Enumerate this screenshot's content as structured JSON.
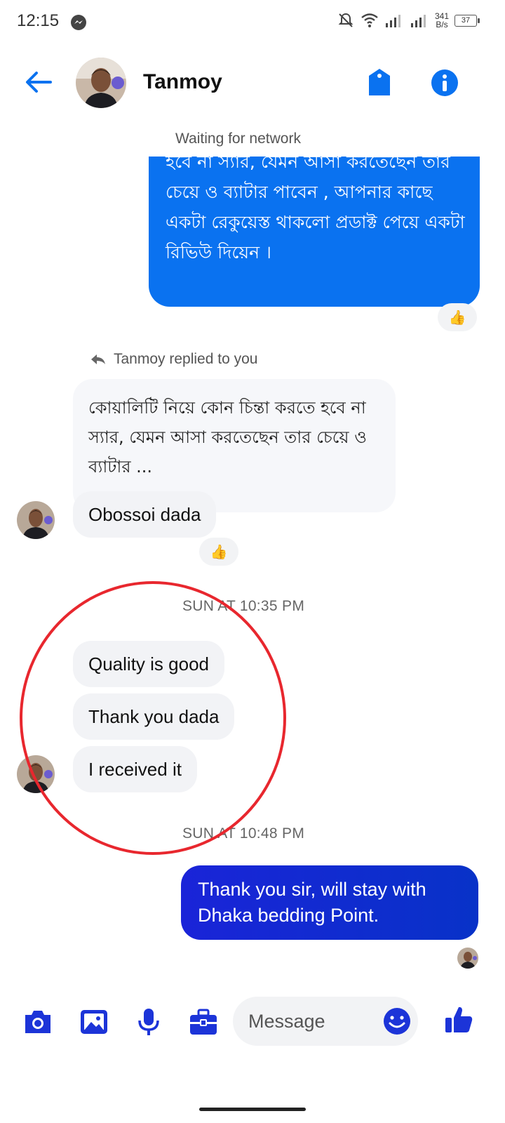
{
  "status_bar": {
    "time": "12:15",
    "net_speed_value": "341",
    "net_speed_unit": "B/s",
    "battery": "37"
  },
  "header": {
    "contact_name": "Tanmoy"
  },
  "network_status": "Waiting for network",
  "messages": {
    "outgoing_1": "হবে না স্যার, যেমন আসা করতেছেন তার চেয়ে ও ব্যাটার পাবেন , আপনার কাছে একটা রেকুয়েস্ত থাকলো প্রডাক্ট পেয়ে একটা রিভিউ দিয়েন ।",
    "reply_label": "Tanmoy replied to you",
    "quoted_text": "কোয়ালিটি নিয়ে কোন চিন্তা করতে হবে না স্যার, যেমন আসা করতেছেন তার চেয়ে ও ব্যাটার ...",
    "incoming_reply": "Obossoi dada",
    "timestamp_1": "SUN AT 10:35 PM",
    "incoming_1": "Quality is good",
    "incoming_2": "Thank you dada",
    "incoming_3": "I received it",
    "timestamp_2": "SUN AT 10:48 PM",
    "outgoing_2": "Thank you sir, will stay with Dhaka bedding Point."
  },
  "reactions": {
    "reaction_1": "👍",
    "reaction_2": "👍"
  },
  "composer": {
    "placeholder": "Message"
  },
  "colors": {
    "accent": "#0a72f0",
    "outgoing_dark": "#1a24d8",
    "annotation": "#e8272e"
  }
}
